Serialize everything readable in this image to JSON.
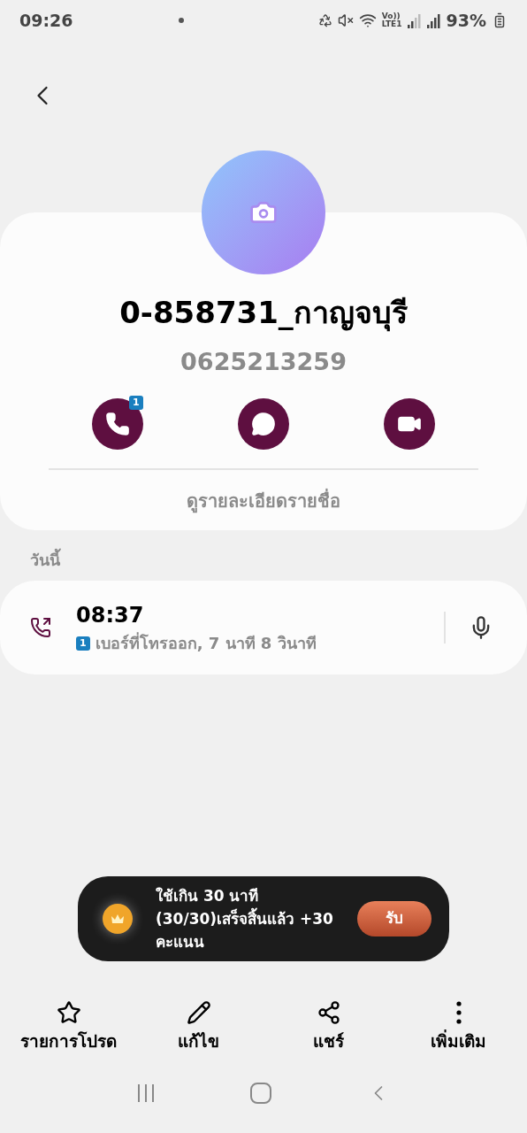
{
  "status_bar": {
    "time": "09:26",
    "battery": "93%",
    "network_label_top": "Vo))",
    "network_label_bottom": "LTE1"
  },
  "contact": {
    "name": "0-858731_กาญจบุรี",
    "number": "0625213259",
    "actions": [
      {
        "kind": "call",
        "badge": "1"
      },
      {
        "kind": "message"
      },
      {
        "kind": "video"
      }
    ],
    "details_link": "ดูรายละเอียดรายชื่อ"
  },
  "history": {
    "section": "วันนี้",
    "entries": [
      {
        "time": "08:37",
        "sim": "1",
        "description": "เบอร์ที่โทรออก, 7 นาที 8 วินาที"
      }
    ]
  },
  "toast": {
    "message": "ใช้เกิน 30 นาที (30/30)เสร็จสิ้นแล้ว +30 คะแนน",
    "button": "รับ"
  },
  "bottom_actions": [
    {
      "kind": "favorite",
      "label": "รายการโปรด"
    },
    {
      "kind": "edit",
      "label": "แก้ไข"
    },
    {
      "kind": "share",
      "label": "แชร์"
    },
    {
      "kind": "more",
      "label": "เพิ่มเติม"
    }
  ]
}
